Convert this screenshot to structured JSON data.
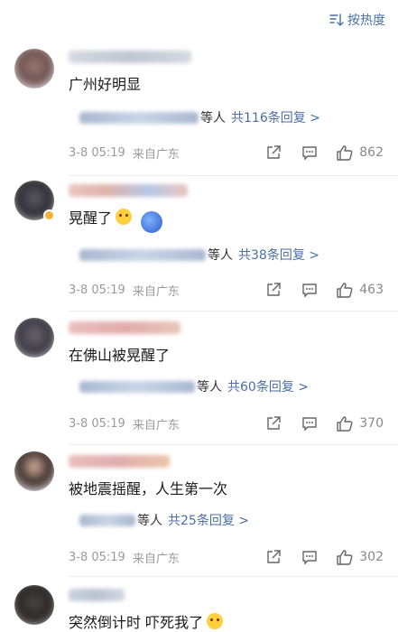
{
  "sort": {
    "label": "按热度"
  },
  "comments": [
    {
      "text": "广州好明显",
      "replies_suffix": "等人",
      "replies_count": "共116条回复 >",
      "date": "3-8 05:19",
      "source": "来自广东",
      "likes": "862",
      "avatar_color": "#8a6a6a"
    },
    {
      "text": "晃醒了",
      "replies_suffix": "等人",
      "replies_count": "共38条回复 >",
      "date": "3-8 05:19",
      "source": "来自广东",
      "likes": "463",
      "avatar_color": "#4a4a55"
    },
    {
      "text": "在佛山被晃醒了",
      "replies_suffix": "等人",
      "replies_count": "共60条回复 >",
      "date": "3-8 05:19",
      "source": "来自广东",
      "likes": "370",
      "avatar_color": "#5b5560"
    },
    {
      "text": "被地震摇醒，人生第一次",
      "replies_suffix": "等人",
      "replies_count": "共25条回复 >",
      "date": "3-8 05:19",
      "source": "来自广东",
      "likes": "302",
      "avatar_color": "#c9a48e"
    },
    {
      "text": "突然倒计时 吓死我了",
      "avatar_color": "#3d3a3a"
    }
  ]
}
